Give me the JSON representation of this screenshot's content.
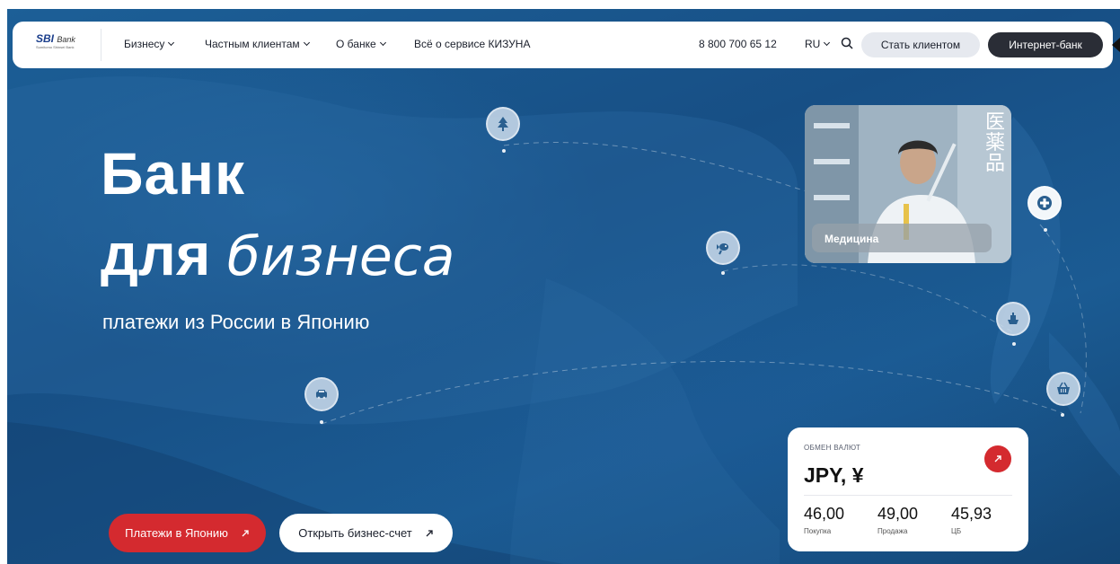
{
  "nav": {
    "logo_main": "SBI",
    "logo_bank": "Bank",
    "logo_tagline": "Sumitomo Shinsei Bank",
    "items": [
      {
        "label": "Бизнесу"
      },
      {
        "label": "Частным клиентам"
      },
      {
        "label": "О банке"
      },
      {
        "label": "Всё о сервисе КИЗУНА"
      }
    ],
    "phone": "8 800 700 65 12",
    "lang": "RU",
    "become_client": "Стать клиентом",
    "internet_bank": "Интернет-банк"
  },
  "hero": {
    "title_line1": "Банк",
    "title_line2_bold": "для",
    "title_line2_italic": "бизнеса",
    "subtitle": "платежи из России в Японию",
    "btn_payments": "Платежи в Японию",
    "btn_open_account": "Открыть бизнес-счет"
  },
  "medicine_card": {
    "kanji": [
      "医",
      "薬",
      "品"
    ],
    "label": "Медицина"
  },
  "fx_card": {
    "title": "ОБМЕН ВАЛЮТ",
    "currency": "JPY, ¥",
    "rates": [
      {
        "value": "46,00",
        "label": "Покупка"
      },
      {
        "value": "49,00",
        "label": "Продажа"
      },
      {
        "value": "45,93",
        "label": "ЦБ"
      }
    ]
  },
  "icons": {
    "pins": [
      "tree-icon",
      "fish-icon",
      "car-icon",
      "plus-icon",
      "ship-icon",
      "basket-icon"
    ]
  },
  "colors": {
    "accent_red": "#d42a2f",
    "dark_button": "#2a2d36",
    "hero_blue": "#1a5a92"
  }
}
